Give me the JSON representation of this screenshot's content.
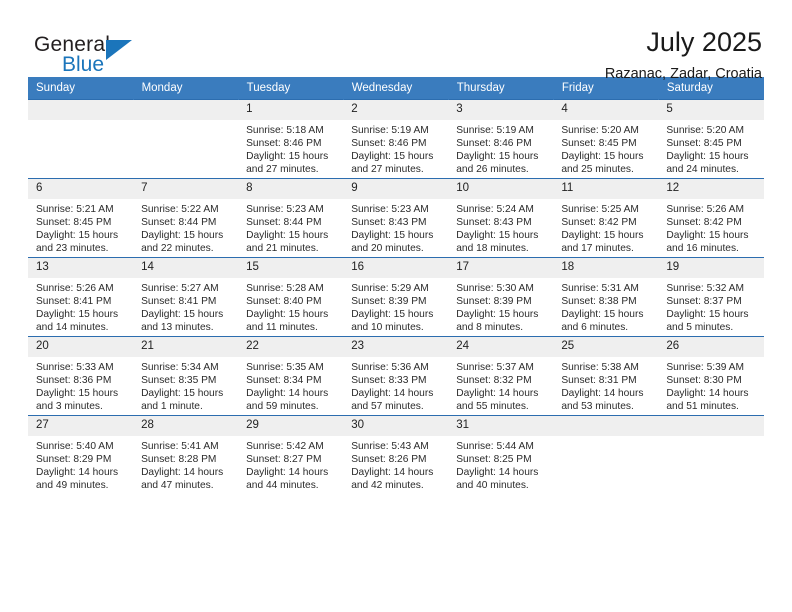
{
  "brand": {
    "general": "General",
    "blue": "Blue",
    "logo_icon": "triangle-logo-icon"
  },
  "header": {
    "title": "July 2025",
    "location": "Razanac, Zadar, Croatia"
  },
  "colors": {
    "header_blue": "#3a7cbe",
    "row_rule_blue": "#2c6daf",
    "daynum_band": "#efefef",
    "brand_blue": "#1b75bb"
  },
  "calendar": {
    "weekdays": [
      "Sunday",
      "Monday",
      "Tuesday",
      "Wednesday",
      "Thursday",
      "Friday",
      "Saturday"
    ],
    "weeks": [
      [
        {
          "day": "",
          "lines": []
        },
        {
          "day": "",
          "lines": []
        },
        {
          "day": "1",
          "lines": [
            "Sunrise: 5:18 AM",
            "Sunset: 8:46 PM",
            "Daylight: 15 hours",
            "and 27 minutes."
          ]
        },
        {
          "day": "2",
          "lines": [
            "Sunrise: 5:19 AM",
            "Sunset: 8:46 PM",
            "Daylight: 15 hours",
            "and 27 minutes."
          ]
        },
        {
          "day": "3",
          "lines": [
            "Sunrise: 5:19 AM",
            "Sunset: 8:46 PM",
            "Daylight: 15 hours",
            "and 26 minutes."
          ]
        },
        {
          "day": "4",
          "lines": [
            "Sunrise: 5:20 AM",
            "Sunset: 8:45 PM",
            "Daylight: 15 hours",
            "and 25 minutes."
          ]
        },
        {
          "day": "5",
          "lines": [
            "Sunrise: 5:20 AM",
            "Sunset: 8:45 PM",
            "Daylight: 15 hours",
            "and 24 minutes."
          ]
        }
      ],
      [
        {
          "day": "6",
          "lines": [
            "Sunrise: 5:21 AM",
            "Sunset: 8:45 PM",
            "Daylight: 15 hours",
            "and 23 minutes."
          ]
        },
        {
          "day": "7",
          "lines": [
            "Sunrise: 5:22 AM",
            "Sunset: 8:44 PM",
            "Daylight: 15 hours",
            "and 22 minutes."
          ]
        },
        {
          "day": "8",
          "lines": [
            "Sunrise: 5:23 AM",
            "Sunset: 8:44 PM",
            "Daylight: 15 hours",
            "and 21 minutes."
          ]
        },
        {
          "day": "9",
          "lines": [
            "Sunrise: 5:23 AM",
            "Sunset: 8:43 PM",
            "Daylight: 15 hours",
            "and 20 minutes."
          ]
        },
        {
          "day": "10",
          "lines": [
            "Sunrise: 5:24 AM",
            "Sunset: 8:43 PM",
            "Daylight: 15 hours",
            "and 18 minutes."
          ]
        },
        {
          "day": "11",
          "lines": [
            "Sunrise: 5:25 AM",
            "Sunset: 8:42 PM",
            "Daylight: 15 hours",
            "and 17 minutes."
          ]
        },
        {
          "day": "12",
          "lines": [
            "Sunrise: 5:26 AM",
            "Sunset: 8:42 PM",
            "Daylight: 15 hours",
            "and 16 minutes."
          ]
        }
      ],
      [
        {
          "day": "13",
          "lines": [
            "Sunrise: 5:26 AM",
            "Sunset: 8:41 PM",
            "Daylight: 15 hours",
            "and 14 minutes."
          ]
        },
        {
          "day": "14",
          "lines": [
            "Sunrise: 5:27 AM",
            "Sunset: 8:41 PM",
            "Daylight: 15 hours",
            "and 13 minutes."
          ]
        },
        {
          "day": "15",
          "lines": [
            "Sunrise: 5:28 AM",
            "Sunset: 8:40 PM",
            "Daylight: 15 hours",
            "and 11 minutes."
          ]
        },
        {
          "day": "16",
          "lines": [
            "Sunrise: 5:29 AM",
            "Sunset: 8:39 PM",
            "Daylight: 15 hours",
            "and 10 minutes."
          ]
        },
        {
          "day": "17",
          "lines": [
            "Sunrise: 5:30 AM",
            "Sunset: 8:39 PM",
            "Daylight: 15 hours",
            "and 8 minutes."
          ]
        },
        {
          "day": "18",
          "lines": [
            "Sunrise: 5:31 AM",
            "Sunset: 8:38 PM",
            "Daylight: 15 hours",
            "and 6 minutes."
          ]
        },
        {
          "day": "19",
          "lines": [
            "Sunrise: 5:32 AM",
            "Sunset: 8:37 PM",
            "Daylight: 15 hours",
            "and 5 minutes."
          ]
        }
      ],
      [
        {
          "day": "20",
          "lines": [
            "Sunrise: 5:33 AM",
            "Sunset: 8:36 PM",
            "Daylight: 15 hours",
            "and 3 minutes."
          ]
        },
        {
          "day": "21",
          "lines": [
            "Sunrise: 5:34 AM",
            "Sunset: 8:35 PM",
            "Daylight: 15 hours",
            "and 1 minute."
          ]
        },
        {
          "day": "22",
          "lines": [
            "Sunrise: 5:35 AM",
            "Sunset: 8:34 PM",
            "Daylight: 14 hours",
            "and 59 minutes."
          ]
        },
        {
          "day": "23",
          "lines": [
            "Sunrise: 5:36 AM",
            "Sunset: 8:33 PM",
            "Daylight: 14 hours",
            "and 57 minutes."
          ]
        },
        {
          "day": "24",
          "lines": [
            "Sunrise: 5:37 AM",
            "Sunset: 8:32 PM",
            "Daylight: 14 hours",
            "and 55 minutes."
          ]
        },
        {
          "day": "25",
          "lines": [
            "Sunrise: 5:38 AM",
            "Sunset: 8:31 PM",
            "Daylight: 14 hours",
            "and 53 minutes."
          ]
        },
        {
          "day": "26",
          "lines": [
            "Sunrise: 5:39 AM",
            "Sunset: 8:30 PM",
            "Daylight: 14 hours",
            "and 51 minutes."
          ]
        }
      ],
      [
        {
          "day": "27",
          "lines": [
            "Sunrise: 5:40 AM",
            "Sunset: 8:29 PM",
            "Daylight: 14 hours",
            "and 49 minutes."
          ]
        },
        {
          "day": "28",
          "lines": [
            "Sunrise: 5:41 AM",
            "Sunset: 8:28 PM",
            "Daylight: 14 hours",
            "and 47 minutes."
          ]
        },
        {
          "day": "29",
          "lines": [
            "Sunrise: 5:42 AM",
            "Sunset: 8:27 PM",
            "Daylight: 14 hours",
            "and 44 minutes."
          ]
        },
        {
          "day": "30",
          "lines": [
            "Sunrise: 5:43 AM",
            "Sunset: 8:26 PM",
            "Daylight: 14 hours",
            "and 42 minutes."
          ]
        },
        {
          "day": "31",
          "lines": [
            "Sunrise: 5:44 AM",
            "Sunset: 8:25 PM",
            "Daylight: 14 hours",
            "and 40 minutes."
          ]
        },
        {
          "day": "",
          "lines": []
        },
        {
          "day": "",
          "lines": []
        }
      ]
    ]
  }
}
